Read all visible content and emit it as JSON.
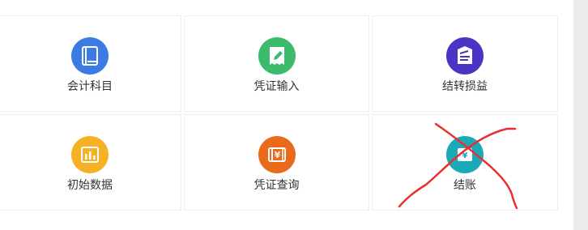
{
  "tiles": [
    {
      "label": "会计科目",
      "icon": "book-icon",
      "color": "#3b7be3"
    },
    {
      "label": "凭证输入",
      "icon": "edit-voucher-icon",
      "color": "#3dbb6d"
    },
    {
      "label": "结转损益",
      "icon": "transfer-profit-loss-icon",
      "color": "#4b33c6"
    },
    {
      "label": "初始数据",
      "icon": "bar-chart-icon",
      "color": "#f7b126"
    },
    {
      "label": "凭证查询",
      "icon": "voucher-yuan-icon",
      "color": "#e86a1a"
    },
    {
      "label": "结账",
      "icon": "closing-account-icon",
      "color": "#1aa9b7"
    }
  ],
  "annotation": {
    "type": "red-cross-mark",
    "color": "#e63030"
  },
  "icon_glyphs": {
    "yuan": "¥"
  }
}
